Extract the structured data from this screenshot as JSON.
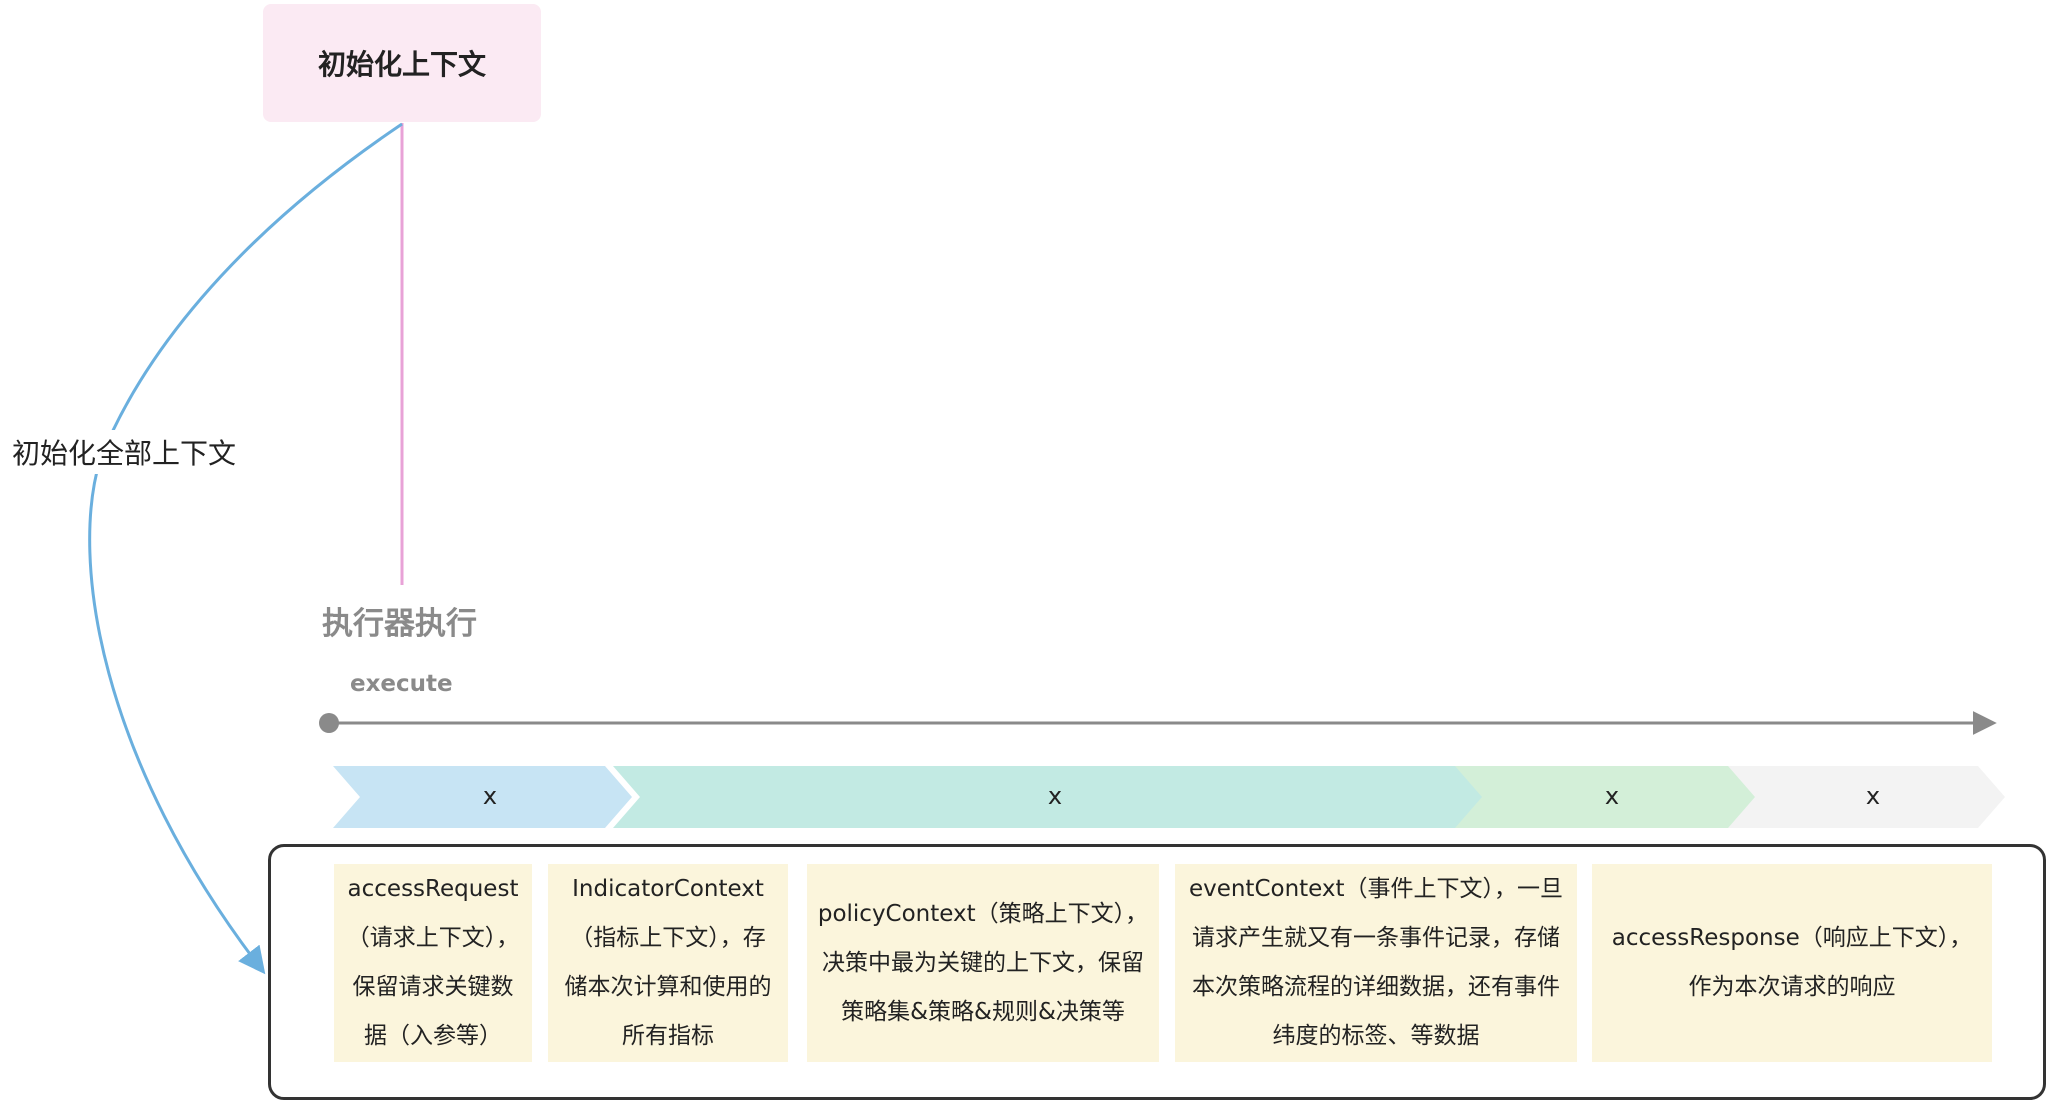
{
  "init_box": {
    "label": "初始化上下文"
  },
  "side_label": "初始化全部上下文",
  "executor": {
    "title": "执行器执行",
    "subtitle": "execute"
  },
  "stages": [
    {
      "label": "x",
      "color": "#c7e4f4"
    },
    {
      "label": "x",
      "color": "#c2eae3"
    },
    {
      "label": "x",
      "color": "#d3efd8"
    },
    {
      "label": "x",
      "color": "#f3f3f3"
    }
  ],
  "cards": [
    {
      "text": "accessRequest\n（请求上下文），\n保留请求关键数\n据（入参等）"
    },
    {
      "text": "IndicatorContext\n（指标上下文），存\n储本次计算和使用的\n所有指标"
    },
    {
      "text": "policyContext（策略上下文），\n决策中最为关键的上下文，保留\n策略集&策略&规则&决策等"
    },
    {
      "text": "eventContext（事件上下文），一旦\n请求产生就又有一条事件记录，存储\n本次策略流程的详细数据，还有事件\n纬度的标签、等数据"
    },
    {
      "text": "accessResponse（响应上下文），\n作为本次请求的响应"
    }
  ],
  "colors": {
    "init_box_bg": "#fbeaf3",
    "pink_line": "#e8a2d7",
    "blue_arrow": "#6aafde",
    "timeline": "#8a8a8a",
    "card_bg": "#fbf5dc"
  }
}
